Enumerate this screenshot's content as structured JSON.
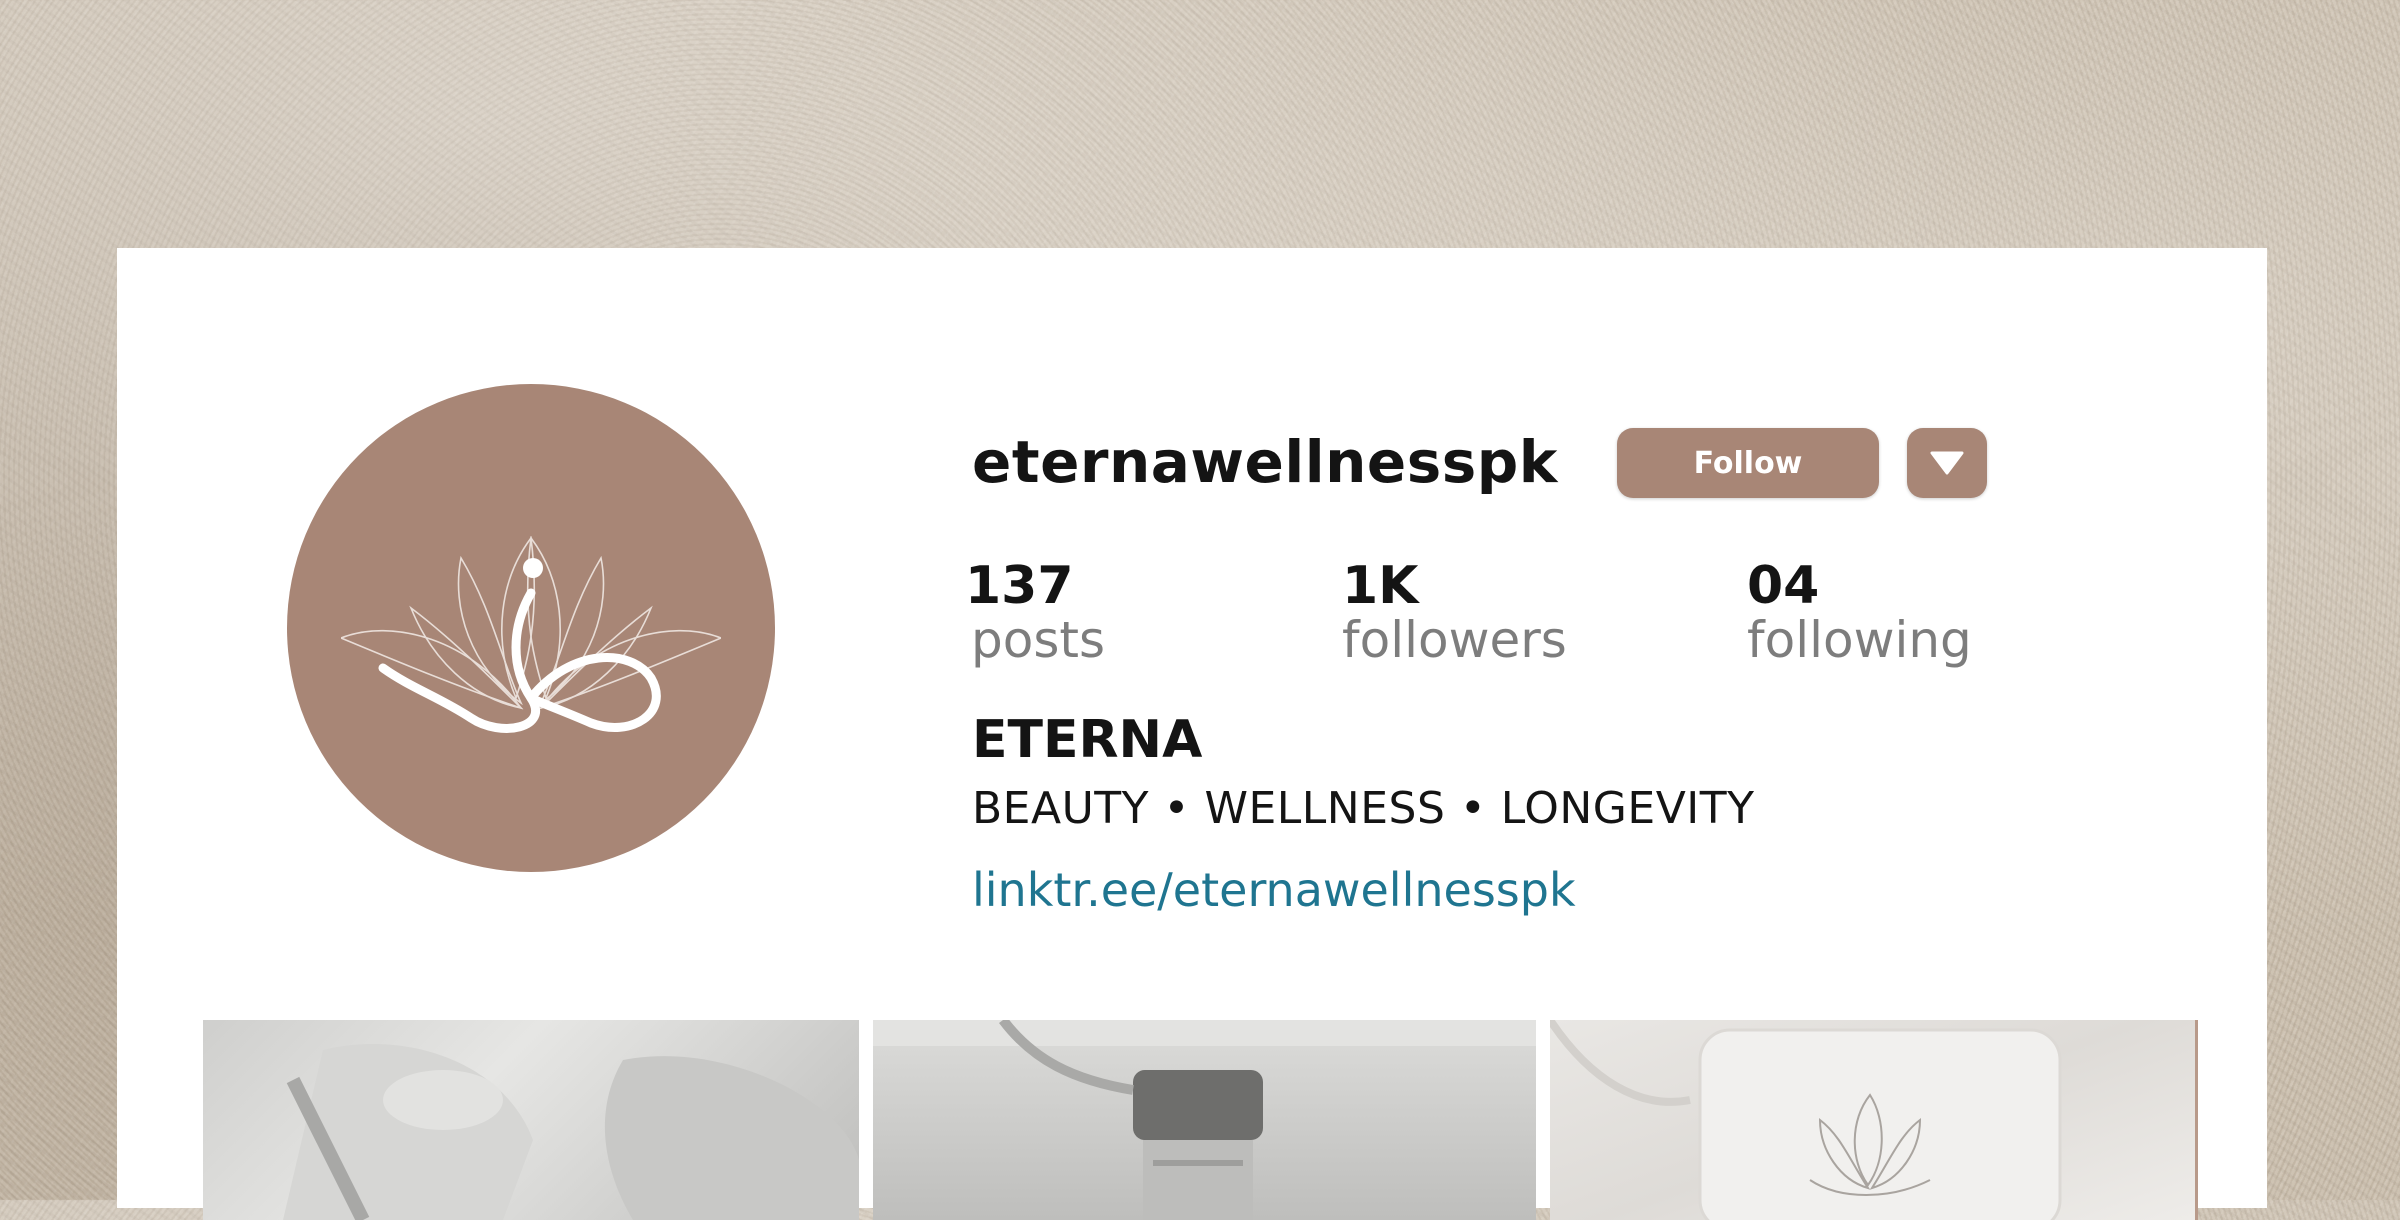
{
  "profile": {
    "username": "eternawellnesspk",
    "follow_label": "Follow",
    "more_icon": "triangle-down-icon",
    "avatar_icon": "lotus-logo-icon"
  },
  "stats": {
    "posts": {
      "value": "137",
      "label": "posts"
    },
    "followers": {
      "value": "1K",
      "label": "followers"
    },
    "following": {
      "value": "04",
      "label": "following"
    }
  },
  "bio": {
    "name": "ETERNA",
    "tagline": "BEAUTY • WELLNESS • LONGEVITY",
    "link": "linktr.ee/eternawellnesspk"
  },
  "grid": {
    "tiles": [
      {
        "subject": "facial-treatment-photo"
      },
      {
        "subject": "serum-dropper-photo"
      },
      {
        "subject": "lotus-pillow-photo"
      }
    ]
  },
  "colors": {
    "brand": "#a88676",
    "link": "#1f7590",
    "text": "#141414",
    "muted": "#7d7d7d",
    "card": "#ffffff"
  }
}
